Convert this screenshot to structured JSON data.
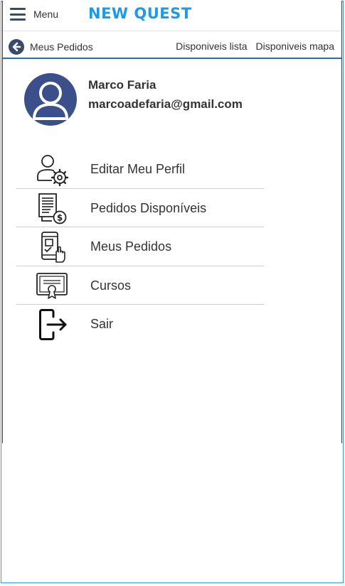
{
  "header": {
    "menu_label": "Menu",
    "brand": "NEW QUEST"
  },
  "subnav": {
    "back_label": "Meus Pedidos",
    "links": [
      "Disponiveis lista",
      "Disponiveis mapa"
    ]
  },
  "profile": {
    "name": "Marco Faria",
    "email": "marcoadefaria@gmail.com"
  },
  "menu": {
    "items": [
      {
        "label": "Editar Meu Perfil",
        "icon": "user-gear-icon"
      },
      {
        "label": "Pedidos Disponíveis",
        "icon": "invoice-dollar-icon"
      },
      {
        "label": "Meus Pedidos",
        "icon": "phone-touch-icon"
      },
      {
        "label": "Cursos",
        "icon": "certificate-icon"
      },
      {
        "label": "Sair",
        "icon": "logout-icon"
      }
    ]
  },
  "colors": {
    "brand": "#1a9be6",
    "nav_dark": "#3b4a6b",
    "avatar": "#3b4f8a",
    "frame": "#2aa3d6"
  }
}
